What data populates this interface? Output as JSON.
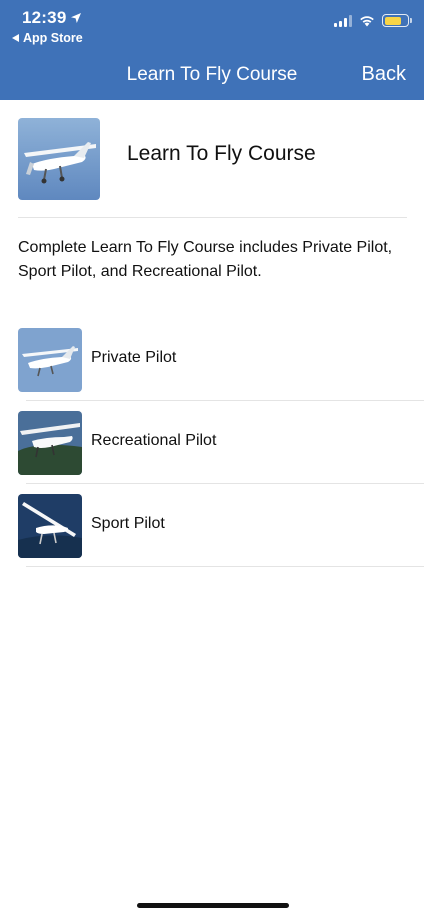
{
  "status_bar": {
    "time": "12:39",
    "back_app_label": "App Store",
    "signal_bars": 3,
    "battery_level": 0.75,
    "colors": {
      "battery_fill": "#f7d447"
    }
  },
  "nav": {
    "title": "Learn To Fly Course",
    "back_label": "Back",
    "colors": {
      "bar_background": "#3f72b8"
    }
  },
  "course": {
    "title": "Learn To Fly Course",
    "image_icon": "airplane-photo",
    "description": "Complete Learn To Fly Course includes Private Pilot, Sport Pilot, and Recreational Pilot."
  },
  "list": {
    "items": [
      {
        "label": "Private Pilot",
        "image_icon": "airplane-photo"
      },
      {
        "label": "Recreational Pilot",
        "image_icon": "airplane-photo"
      },
      {
        "label": "Sport Pilot",
        "image_icon": "glider-photo"
      }
    ]
  }
}
